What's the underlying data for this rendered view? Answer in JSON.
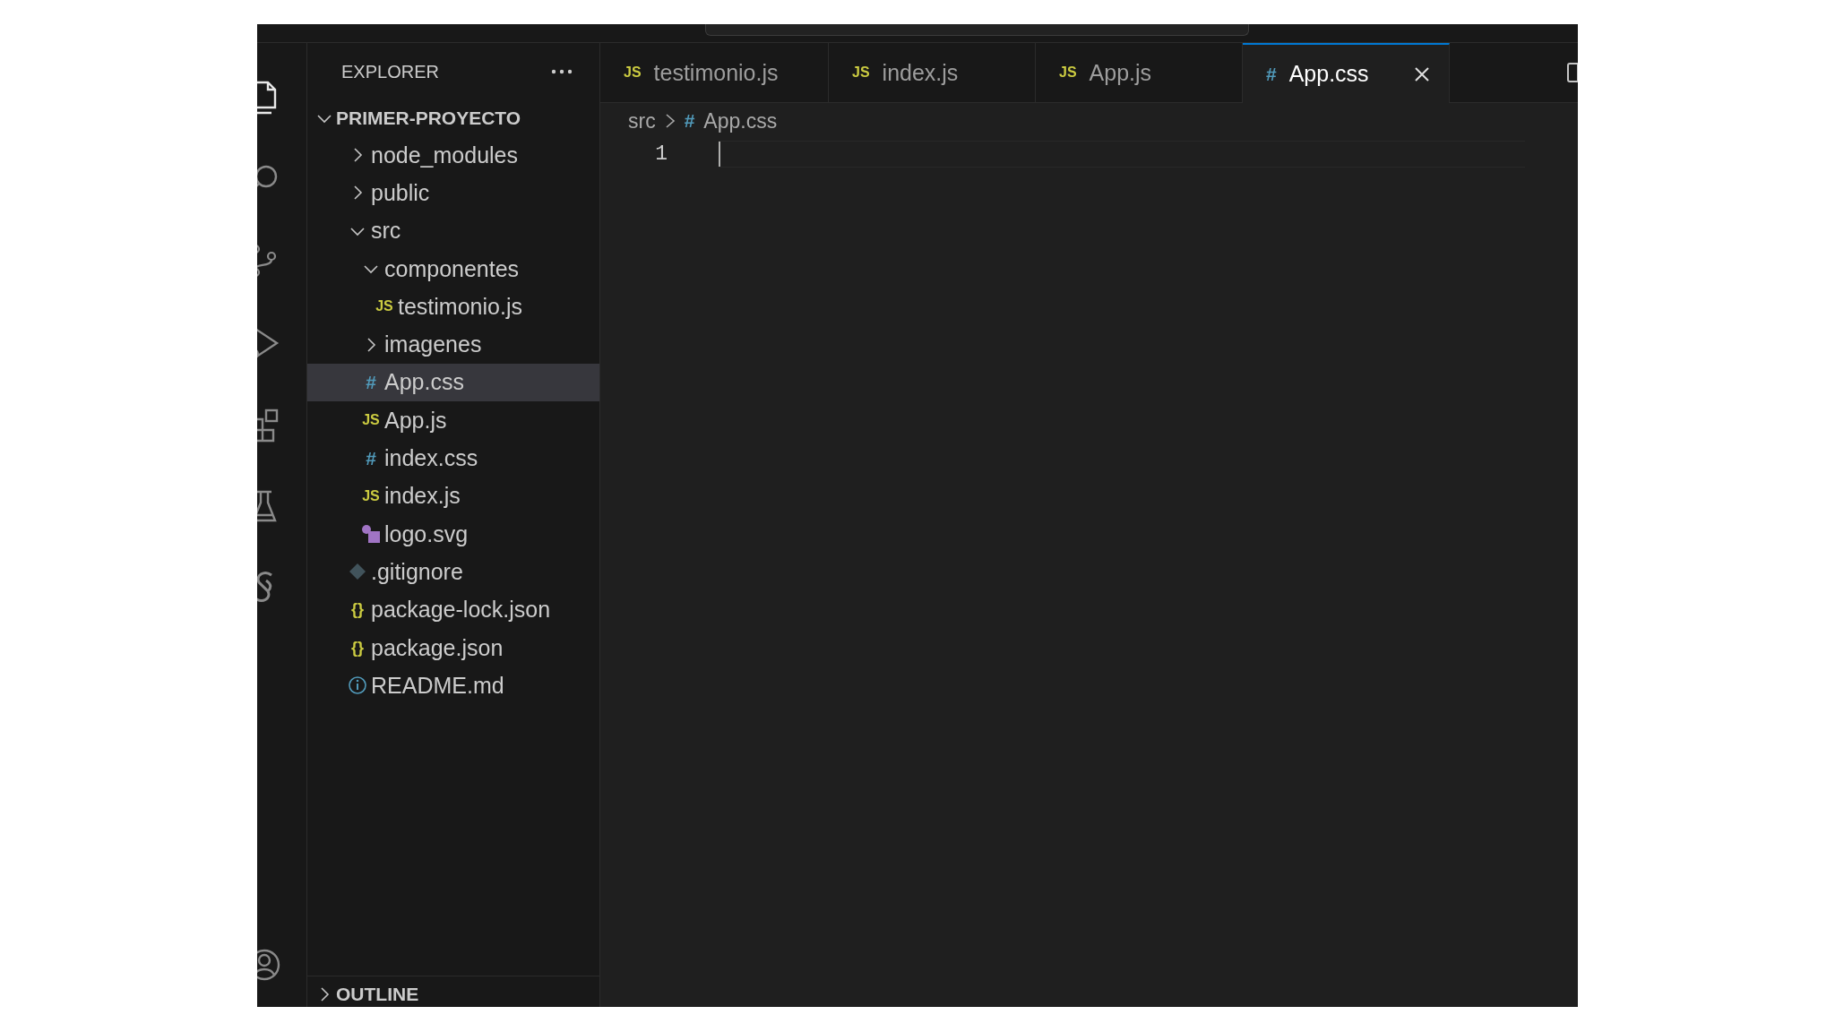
{
  "activity_bar": {
    "items": [
      {
        "kind": "files",
        "selected": true
      },
      {
        "kind": "search",
        "selected": false
      },
      {
        "kind": "source-control",
        "selected": false
      },
      {
        "kind": "run-debug",
        "selected": false
      },
      {
        "kind": "extensions",
        "selected": false
      },
      {
        "kind": "testing",
        "selected": false
      },
      {
        "kind": "extension-s",
        "selected": false
      }
    ],
    "bottom_items": [
      {
        "kind": "account",
        "selected": false
      }
    ]
  },
  "sidebar": {
    "title": "EXPLORER",
    "tree": {
      "label": "PRIMER-PROYECTO",
      "expanded": true,
      "children": [
        {
          "label": "node_modules",
          "kind": "folder",
          "expanded": false,
          "selected": false
        },
        {
          "label": "public",
          "kind": "folder",
          "expanded": false,
          "selected": false
        },
        {
          "label": "src",
          "kind": "folder",
          "expanded": true,
          "selected": false,
          "children": [
            {
              "label": "componentes",
              "kind": "folder",
              "expanded": true,
              "selected": false,
              "children": [
                {
                  "label": "testimonio.js",
                  "kind": "js",
                  "glyph": "JS",
                  "selected": false
                }
              ]
            },
            {
              "label": "imagenes",
              "kind": "folder",
              "expanded": false,
              "selected": false
            },
            {
              "label": "App.css",
              "kind": "css",
              "glyph": "#",
              "selected": true
            },
            {
              "label": "App.js",
              "kind": "js",
              "glyph": "JS",
              "selected": false
            },
            {
              "label": "index.css",
              "kind": "css",
              "glyph": "#",
              "selected": false
            },
            {
              "label": "index.js",
              "kind": "js",
              "glyph": "JS",
              "selected": false
            },
            {
              "label": "logo.svg",
              "kind": "svg",
              "selected": false
            }
          ]
        },
        {
          "label": ".gitignore",
          "kind": "git",
          "selected": false
        },
        {
          "label": "package-lock.json",
          "kind": "json",
          "glyph": "{}",
          "selected": false
        },
        {
          "label": "package.json",
          "kind": "json",
          "glyph": "{}",
          "selected": false
        },
        {
          "label": "README.md",
          "kind": "info",
          "selected": false
        }
      ]
    },
    "outline": {
      "label": "OUTLINE",
      "expanded": false
    }
  },
  "tabs": [
    {
      "label": "testimonio.js",
      "kind": "js",
      "glyph": "JS",
      "selected": false
    },
    {
      "label": "index.js",
      "kind": "js",
      "glyph": "JS",
      "selected": false
    },
    {
      "label": "App.js",
      "kind": "js",
      "glyph": "JS",
      "selected": false
    },
    {
      "label": "App.css",
      "kind": "css",
      "glyph": "#",
      "selected": true
    }
  ],
  "breadcrumb": [
    {
      "label": "src",
      "kind": "folder"
    },
    {
      "label": "App.css",
      "kind": "css",
      "glyph": "#"
    }
  ],
  "editor": {
    "lines": [
      {
        "number": "1",
        "current": true
      }
    ]
  }
}
